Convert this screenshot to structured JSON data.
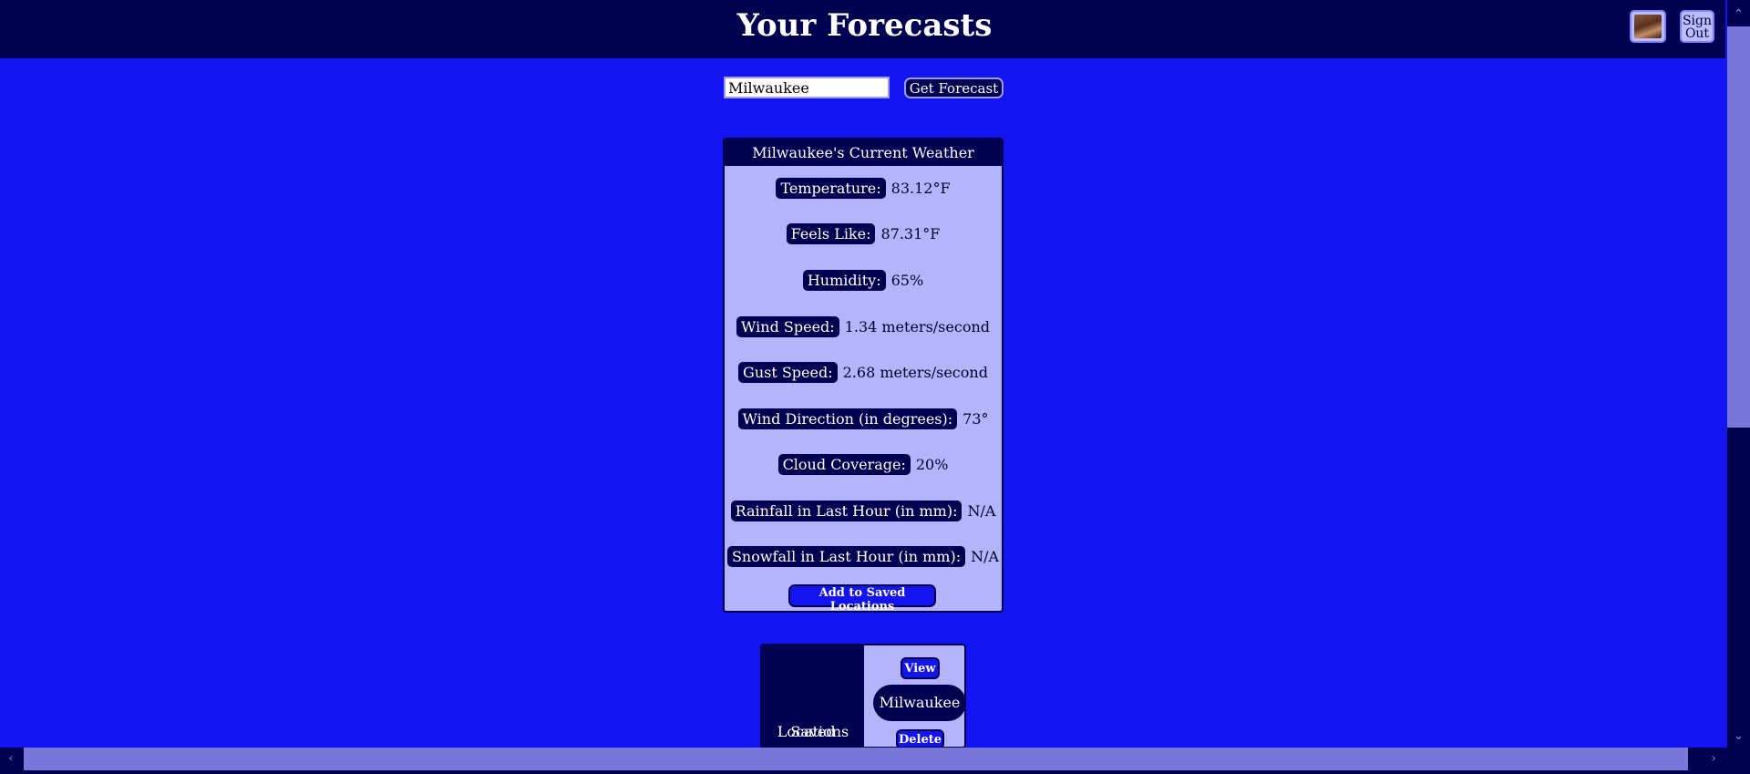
{
  "header": {
    "title": "Your Forecasts",
    "signout_line1": "Sign",
    "signout_line2": "Out"
  },
  "search": {
    "value": "Milwaukee",
    "button_label": "Get Forecast"
  },
  "weather": {
    "title": "Milwaukee's Current Weather",
    "rows": [
      {
        "label": "Temperature:",
        "value": "83.12°F"
      },
      {
        "label": "Feels Like:",
        "value": "87.31°F"
      },
      {
        "label": "Humidity:",
        "value": "65%"
      },
      {
        "label": "Wind Speed:",
        "value": "1.34 meters/second"
      },
      {
        "label": "Gust Speed:",
        "value": "2.68 meters/second"
      },
      {
        "label": "Wind Direction (in degrees):",
        "value": "73°"
      },
      {
        "label": "Cloud Coverage:",
        "value": "20%"
      },
      {
        "label": "Rainfall in Last Hour (in mm):",
        "value": "N/A"
      },
      {
        "label": "Snowfall in Last Hour (in mm):",
        "value": "N/A"
      }
    ],
    "add_button": "Add to Saved Locations"
  },
  "saved": {
    "heading_line1": "Saved",
    "heading_line2": "Locations",
    "view_label": "View",
    "location": "Milwaukee",
    "delete_label": "Delete"
  },
  "colors": {
    "background": "#1414f0",
    "navy": "#000050",
    "card": "#b4b4fc"
  },
  "icons": {
    "avatar": "user-avatar-icon",
    "scroll_up": "chevron-up-icon",
    "scroll_down": "chevron-down-icon",
    "scroll_left": "chevron-left-icon",
    "scroll_right": "chevron-right-icon"
  }
}
